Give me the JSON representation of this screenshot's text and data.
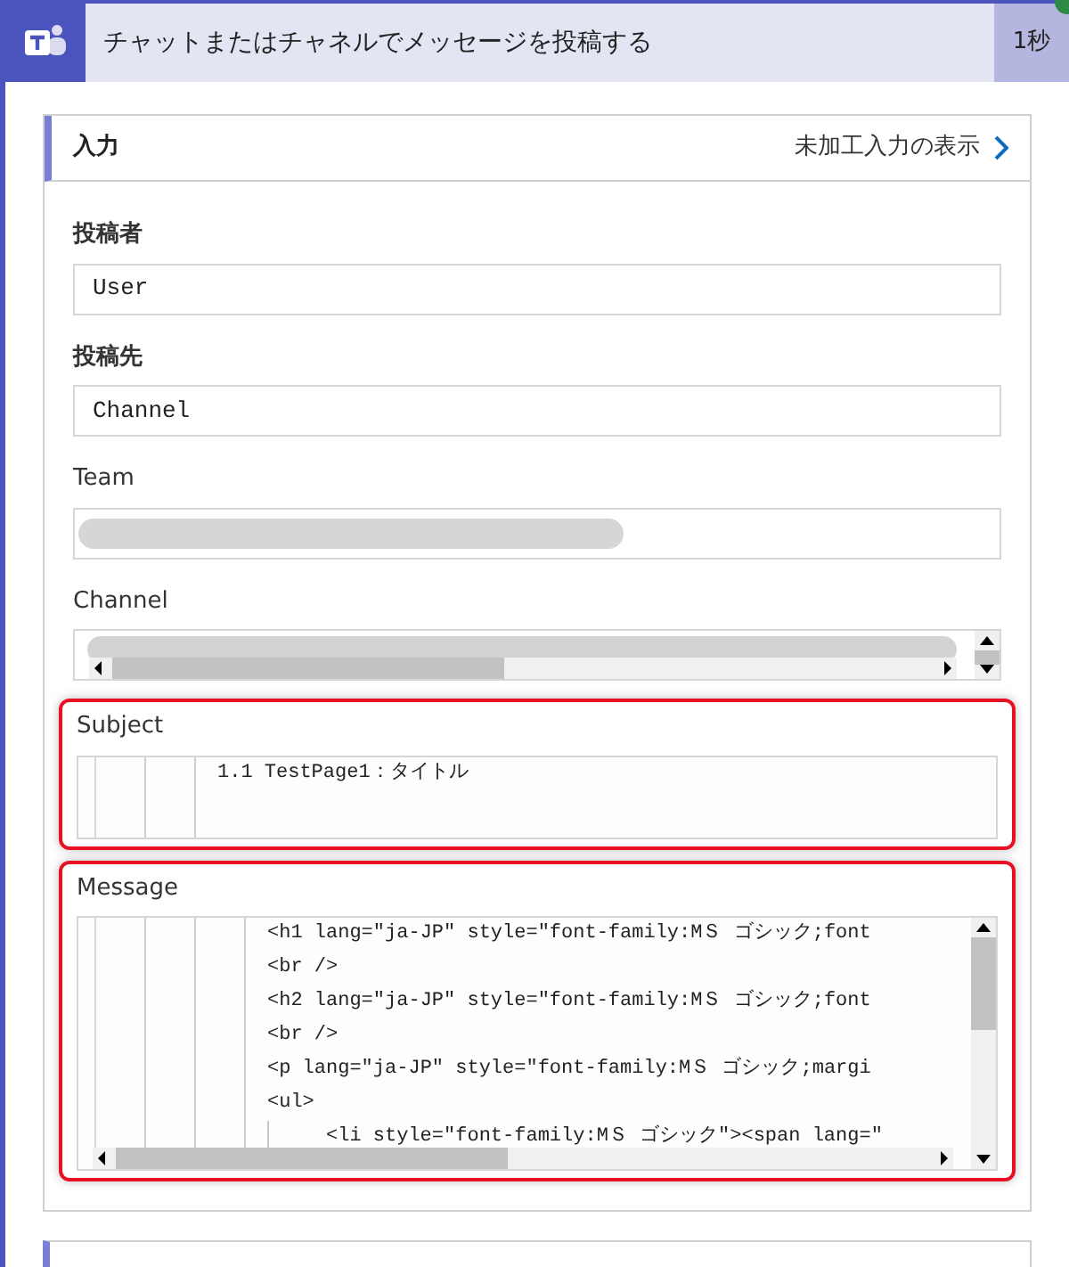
{
  "header": {
    "title": "チャットまたはチャネルでメッセージを投稿する",
    "duration": "1秒",
    "succeeded": true
  },
  "inputs": {
    "title": "入力",
    "raw_link": "未加工入力の表示",
    "fields": [
      {
        "kind": "text",
        "label": "投稿者",
        "value": "User",
        "highlighted": false
      },
      {
        "kind": "text",
        "label": "投稿先",
        "value": "Channel",
        "highlighted": false
      },
      {
        "kind": "redacted",
        "label": "Team",
        "highlighted": false
      },
      {
        "kind": "redacted-scroll",
        "label": "Channel",
        "highlighted": false
      },
      {
        "kind": "code",
        "label": "Subject",
        "highlighted": true,
        "lines": [
          {
            "text": "1.1 TestPage1：タイトル"
          }
        ]
      },
      {
        "kind": "code-scroll",
        "label": "Message",
        "highlighted": true,
        "lines": [
          {
            "text": "<h1 lang=\"ja-JP\" style=\"font-family:MＳ ゴシック;font"
          },
          {
            "text": "<br />"
          },
          {
            "text": "<h2 lang=\"ja-JP\" style=\"font-family:MＳ ゴシック;font"
          },
          {
            "text": "<br />"
          },
          {
            "text": "<p lang=\"ja-JP\" style=\"font-family:MＳ ゴシック;margi"
          },
          {
            "text": "<ul>",
            "children": [
              {
                "text": "<li style=\"font-family:MＳ ゴシック\"><span lang=\""
              }
            ]
          }
        ]
      }
    ]
  }
}
